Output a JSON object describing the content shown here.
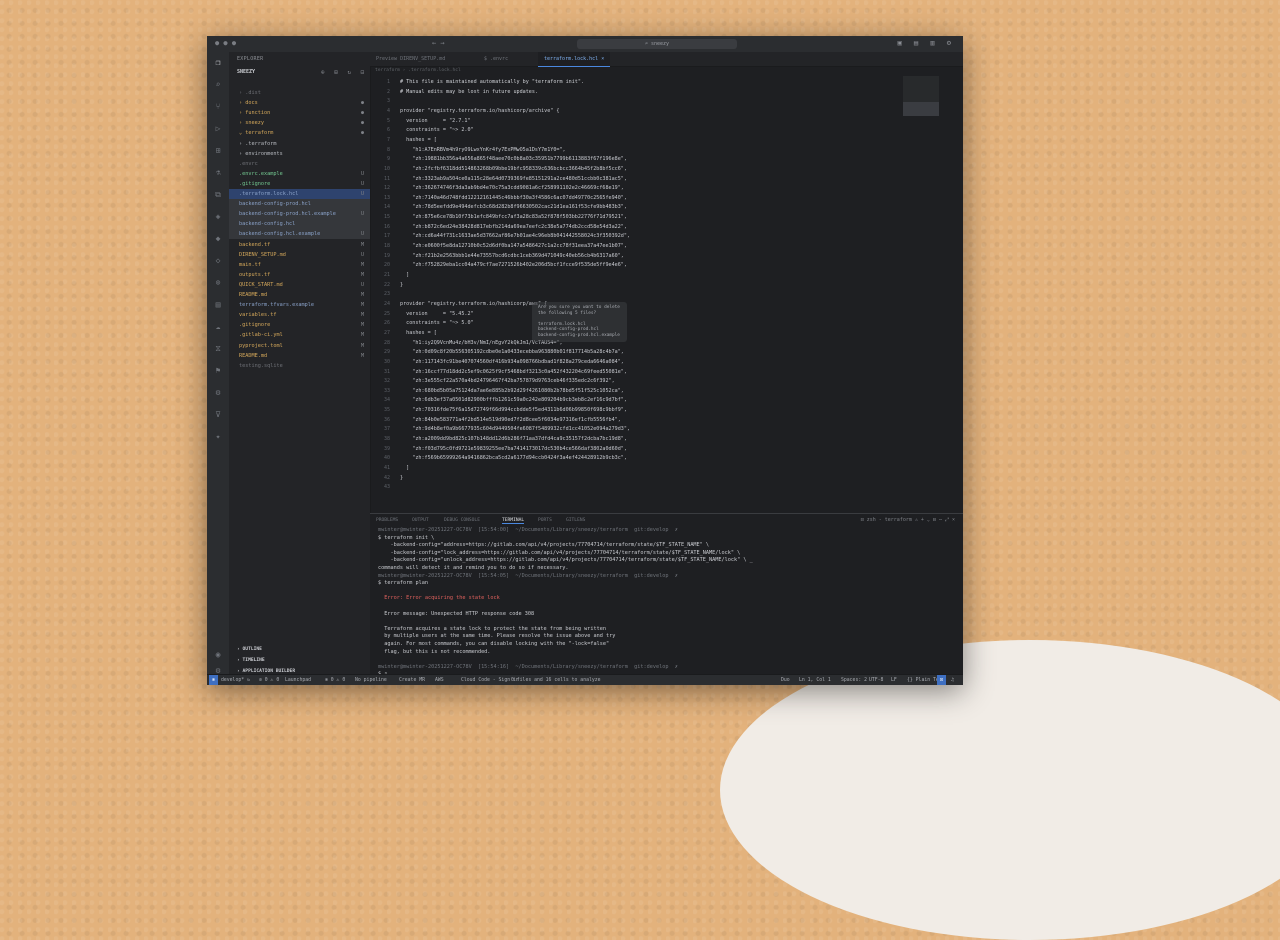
{
  "window": {
    "search_text": "sneezy",
    "nav_text": "← →",
    "title_icons": "▣ ▤ ▥ ⚙"
  },
  "sidebar": {
    "header": "EXPLORER",
    "project": "SNEEZY",
    "tools": "⊕ ⊞ ↻ ⊟",
    "items": [
      {
        "label": "› .dist",
        "status": "",
        "color": "#6e7076"
      },
      {
        "label": "› docs",
        "status": "●",
        "color": "#d6a95b"
      },
      {
        "label": "› function",
        "status": "●",
        "color": "#d6a95b"
      },
      {
        "label": "› sneezy",
        "status": "●",
        "color": "#d6a95b"
      },
      {
        "label": "⌄ terraform",
        "status": "●",
        "color": "#d6a95b"
      },
      {
        "label": "  › .terraform",
        "status": "",
        "color": "#b9bcc2"
      },
      {
        "label": "  › environments",
        "status": "",
        "color": "#b9bcc2"
      },
      {
        "label": "    .envrc",
        "status": "",
        "color": "#6e7076"
      },
      {
        "label": "    .envrc.example",
        "status": "U",
        "color": "#73c991"
      },
      {
        "label": "    .gitignore",
        "status": "U",
        "color": "#73c991"
      },
      {
        "label": "    .terraform.lock.hcl",
        "status": "U",
        "color": "#8aa2c9"
      },
      {
        "label": "    backend-config-prod.hcl",
        "status": "",
        "color": "#8aa2c9"
      },
      {
        "label": "    backend-config-prod.hcl.example",
        "status": "U",
        "color": "#8aa2c9"
      },
      {
        "label": "    backend-config.hcl",
        "status": "",
        "color": "#8aa2c9"
      },
      {
        "label": "    backend-config.hcl.example",
        "status": "U",
        "color": "#8aa2c9"
      },
      {
        "label": "    backend.tf",
        "status": "M",
        "color": "#d6a95b"
      },
      {
        "label": "    DIRENV_SETUP.md",
        "status": "U",
        "color": "#d6a95b"
      },
      {
        "label": "    main.tf",
        "status": "M",
        "color": "#d6a95b"
      },
      {
        "label": "    outputs.tf",
        "status": "M",
        "color": "#d6a95b"
      },
      {
        "label": "    QUICK_START.md",
        "status": "U",
        "color": "#d6a95b"
      },
      {
        "label": "    README.md",
        "status": "M",
        "color": "#d6a95b"
      },
      {
        "label": "    terraform.tfvars.example",
        "status": "M",
        "color": "#8aa2c9"
      },
      {
        "label": "    variables.tf",
        "status": "M",
        "color": "#d6a95b"
      },
      {
        "label": "  .gitignore",
        "status": "M",
        "color": "#d6a95b"
      },
      {
        "label": "  .gitlab-ci.yml",
        "status": "M",
        "color": "#d6a95b"
      },
      {
        "label": "  pyproject.toml",
        "status": "M",
        "color": "#d6a95b"
      },
      {
        "label": "  README.md",
        "status": "M",
        "color": "#d6a95b"
      },
      {
        "label": "  testing.sqlite",
        "status": "",
        "color": "#6e7076"
      }
    ],
    "bottom": [
      "› OUTLINE",
      "› TIMELINE",
      "› APPLICATION BUILDER"
    ]
  },
  "tabs": [
    {
      "label": "Preview DIRENV_SETUP.md"
    },
    {
      "label": "$ .envrc"
    },
    {
      "label": "terraform.lock.hcl  ×"
    }
  ],
  "breadcrumb": "terraform  ›  .terraform.lock.hcl",
  "code_lines": [
    {
      "n": "1",
      "t": "# This file is maintained automatically by \"terraform init\".",
      "c": "comment"
    },
    {
      "n": "2",
      "t": "# Manual edits may be lost in future updates.",
      "c": "comment"
    },
    {
      "n": "3",
      "t": "",
      "c": ""
    },
    {
      "n": "4",
      "t": "provider \"registry.terraform.io/hashicorp/archive\" {",
      "c": ""
    },
    {
      "n": "5",
      "t": "  version     = \"2.7.1\"",
      "c": ""
    },
    {
      "n": "6",
      "t": "  constraints = \"~> 2.0\"",
      "c": ""
    },
    {
      "n": "7",
      "t": "  hashes = [",
      "c": ""
    },
    {
      "n": "8",
      "t": "    \"h1:A7EnRBVm4h9ryO9LwxYnKr4fy7ExPMwO5a1DsY7m1Y0=\",",
      "c": ""
    },
    {
      "n": "9",
      "t": "    \"zh:19881bb356a4a656a865f48aee70c0b8a03c35951b7799b6113883f67f196e8e\",",
      "c": ""
    },
    {
      "n": "10",
      "t": "    \"zh:2fcfbf6318dd514863268b09bbe19bfc958339c636bcbcc3664b45f2b8bf5cc6\",",
      "c": ""
    },
    {
      "n": "11",
      "t": "    \"zh:3323ab9a504ce0a115c28e64d0739369fe85151291a2ce480d51ccbb0c381ac5\",",
      "c": ""
    },
    {
      "n": "12",
      "t": "    \"zh:362674746f3da3ab9bd4e70c75a3cdd9081a6cf258991102e2c46669cf68e19\",",
      "c": ""
    },
    {
      "n": "13",
      "t": "    \"zh:7140a46d748fdd12212161445c46bbbf30a3f4586c6ac07dd49770c2565fe940\",",
      "c": ""
    },
    {
      "n": "14",
      "t": "    \"zh:78d5eefdd9e494defcb3c68d282b8f96630502cac21d1ea161f53cfe9bb483b3\",",
      "c": ""
    },
    {
      "n": "15",
      "t": "    \"zh:875e6ce78b10f73b1efc849bfcc7af3a28c83a52f878f503bb22776f71d79521\",",
      "c": ""
    },
    {
      "n": "16",
      "t": "    \"zh:b872c6ed24e38428d817ebfb214da69ea7eefc2c38e5a774db2ccd58e54d3a22\",",
      "c": ""
    },
    {
      "n": "17",
      "t": "    \"zh:cd6a44f731c1633ae5d37662af86e7b01ae4c96eb8b041442558024c3f350392d\",",
      "c": ""
    },
    {
      "n": "18",
      "t": "    \"zh:e0600f5e8da12710b0c52d6df0ba147a5486427c1a2cc78f31eea37a47ee1b07\",",
      "c": ""
    },
    {
      "n": "19",
      "t": "    \"zh:f21b2e2563bbb1e44e73557bcd6cdbc1ceb369d471049c40eb56cb4b6317a60\",",
      "c": ""
    },
    {
      "n": "20",
      "t": "    \"zh:f752829eba1cc04a479cf7ae7271526b402e206d5bcf1fcce9f535de5ff9e4e6\",",
      "c": ""
    },
    {
      "n": "21",
      "t": "  ]",
      "c": ""
    },
    {
      "n": "22",
      "t": "}",
      "c": ""
    },
    {
      "n": "23",
      "t": "",
      "c": ""
    },
    {
      "n": "24",
      "t": "provider \"registry.terraform.io/hashicorp/aws\" {",
      "c": ""
    },
    {
      "n": "25",
      "t": "  version     = \"5.45.2\"",
      "c": ""
    },
    {
      "n": "26",
      "t": "  constraints = \"~> 5.0\"",
      "c": ""
    },
    {
      "n": "27",
      "t": "  hashes = [",
      "c": ""
    },
    {
      "n": "28",
      "t": "    \"h1:iy2Q9VcnMu4z/bH3v/NmI/nEgvY2kQkJm1/VcTAU54=\",",
      "c": ""
    },
    {
      "n": "29",
      "t": "    \"zh:0d09c8f20b556305192cdbe0e1a0433ecebba963880b01f817714b5a28c4b7a\",",
      "c": ""
    },
    {
      "n": "30",
      "t": "    \"zh:117143fc91be407074560df416b934a098766bdbad1f828a279ceda6646a084\",",
      "c": ""
    },
    {
      "n": "31",
      "t": "    \"zh:16ccf77d18dd2c5ef9c0625f9cf5468bdf3213c0a452f432204c69feed55081e\",",
      "c": ""
    },
    {
      "n": "32",
      "t": "    \"zh:3e555cf22a570a4bd24796467f42ba757879d9763ceb46f335edc2c6f392\",",
      "c": ""
    },
    {
      "n": "33",
      "t": "    \"zh:680bd5b05a75124da7ae6e885b2b92d29f4261080b2b78bd5f51f525c1052ca\",",
      "c": ""
    },
    {
      "n": "34",
      "t": "    \"zh:6db3ef37a0501d82900bfffb1261c59a0c242e809204b9cb3eb8c2ef16c9d7bf\",",
      "c": ""
    },
    {
      "n": "35",
      "t": "    \"zh:70316fde75f6a15d72749f66d994ccbdde5f5ed4311b6d06b99850f698c9bbf9\",",
      "c": ""
    },
    {
      "n": "36",
      "t": "    \"zh:84b0e583771a4f2bd514e519d90ed7f2d8cee5f6034e97316ef1cfb5556fb4\",",
      "c": ""
    },
    {
      "n": "37",
      "t": "    \"zh:9d4b8ef0a9b6677935c604d9449504fe6087f5489932cfd1cc41052e094a279d3\",",
      "c": ""
    },
    {
      "n": "38",
      "t": "    \"zh:a2009dd9bd825c107b148dd12d6b286f71aa37dfd4ca9c35157f2dcba7bc19d8\",",
      "c": ""
    },
    {
      "n": "39",
      "t": "    \"zh:f03d795c0fd9721e59839255ee7ba7414173017dc530b4ce566daf3802a0d60d\",",
      "c": ""
    },
    {
      "n": "40",
      "t": "    \"zh:f569b65999264a9416862bca5cd2a6177d94ccb0424f3a4ef424428912b9cb3c\",",
      "c": ""
    },
    {
      "n": "41",
      "t": "  ]",
      "c": ""
    },
    {
      "n": "42",
      "t": "}",
      "c": ""
    },
    {
      "n": "43",
      "t": "",
      "c": ""
    }
  ],
  "popup": [
    "Are you sure you want to delete",
    "the following 5 files?",
    "",
    "terraform.lock.hcl",
    "backend-config-prod.hcl",
    "backend-config-prod.hcl.example"
  ],
  "panel": {
    "tabs": [
      "PROBLEMS",
      "OUTPUT",
      "DEBUG CONSOLE",
      "TERMINAL",
      "PORTS",
      "GITLENS"
    ],
    "right": "⊡ zsh - terraform  ⚠  +  ⌄  ⊟  ⋯  ⤢  ×",
    "lines": [
      {
        "t": "mwinter@mwinter-20251227-OC78V  [15:54:00]  ~/Documents/Library/sneezy/terraform  git:develop  ✗",
        "c": "dim"
      },
      {
        "t": "$ terraform init \\",
        "c": ""
      },
      {
        "t": "    -backend-config=\"address=https://gitlab.com/api/v4/projects/77704714/terraform/state/$TF_STATE_NAME\" \\",
        "c": ""
      },
      {
        "t": "    -backend-config=\"lock_address=https://gitlab.com/api/v4/projects/77704714/terraform/state/$TF_STATE_NAME/lock\" \\",
        "c": ""
      },
      {
        "t": "    -backend-config=\"unlock_address=https://gitlab.com/api/v4/projects/77704714/terraform/state/$TF_STATE_NAME/lock\" \\ _",
        "c": ""
      },
      {
        "t": "commands will detect it and remind you to do so if necessary.",
        "c": ""
      },
      {
        "t": "mwinter@mwinter-20251227-OC78V  [15:54:05]  ~/Documents/Library/sneezy/terraform  git:develop  ✗",
        "c": "dim"
      },
      {
        "t": "$ terraform plan",
        "c": ""
      },
      {
        "t": "",
        "c": ""
      },
      {
        "t": "  Error: Error acquiring the state lock",
        "c": "errline"
      },
      {
        "t": "",
        "c": ""
      },
      {
        "t": "  Error message: Unexpected HTTP response code 308",
        "c": ""
      },
      {
        "t": "",
        "c": ""
      },
      {
        "t": "  Terraform acquires a state lock to protect the state from being written",
        "c": ""
      },
      {
        "t": "  by multiple users at the same time. Please resolve the issue above and try",
        "c": ""
      },
      {
        "t": "  again. For most commands, you can disable locking with the \"-lock=false\"",
        "c": ""
      },
      {
        "t": "  flag, but this is not recommended.",
        "c": ""
      },
      {
        "t": "",
        "c": ""
      },
      {
        "t": "mwinter@mwinter-20251227-OC78V  [15:54:16]  ~/Documents/Library/sneezy/terraform  git:develop  ✗",
        "c": "dim"
      },
      {
        "t": "$ ▯",
        "c": ""
      }
    ]
  },
  "status": {
    "left": [
      "⊗",
      "develop*",
      "↻",
      "⊘ 0 ⚠ 0",
      "Launchpad",
      "⊗ 0 ⚠ 0",
      "No pipeline",
      "Create MR",
      "AWS",
      "Cloud Code - Sign in",
      "0 files and 16 cells to analyze"
    ],
    "right": [
      "Duo",
      "Ln 1, Col 1",
      "Spaces: 2",
      "UTF-8",
      "LF",
      "{} Plain Text",
      "⊡",
      "♫"
    ]
  }
}
